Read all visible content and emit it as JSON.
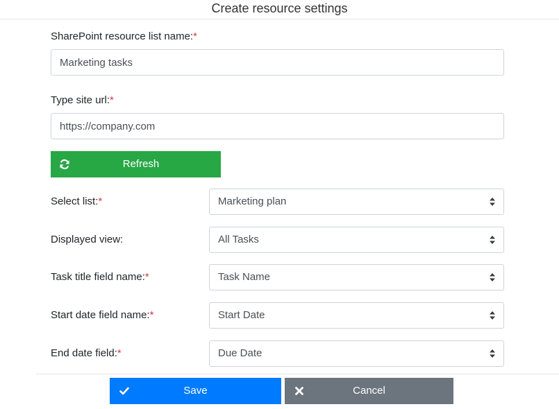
{
  "dialog": {
    "title": "Create resource settings"
  },
  "form": {
    "list_name": {
      "label": "SharePoint resource list name:",
      "required_mark": "*",
      "value": "Marketing tasks"
    },
    "site_url": {
      "label": "Type site url:",
      "required_mark": "*",
      "value": "https://company.com"
    },
    "refresh": {
      "label": "Refresh",
      "icon": "refresh-icon"
    },
    "select_list": {
      "label": "Select list:",
      "required_mark": "*",
      "value": "Marketing plan"
    },
    "displayed_view": {
      "label": "Displayed view:",
      "value": "All Tasks"
    },
    "task_title_field": {
      "label": "Task title field name:",
      "required_mark": "*",
      "value": "Task Name"
    },
    "start_date_field": {
      "label": "Start date field name:",
      "required_mark": "*",
      "value": "Start Date"
    },
    "end_date_field": {
      "label": "End date field:",
      "required_mark": "*",
      "value": "Due Date"
    }
  },
  "footer": {
    "save": {
      "label": "Save",
      "icon": "check-icon"
    },
    "cancel": {
      "label": "Cancel",
      "icon": "close-icon"
    }
  },
  "colors": {
    "success": "#28a745",
    "primary": "#007bff",
    "secondary": "#6c757d",
    "required": "#dc3545"
  }
}
